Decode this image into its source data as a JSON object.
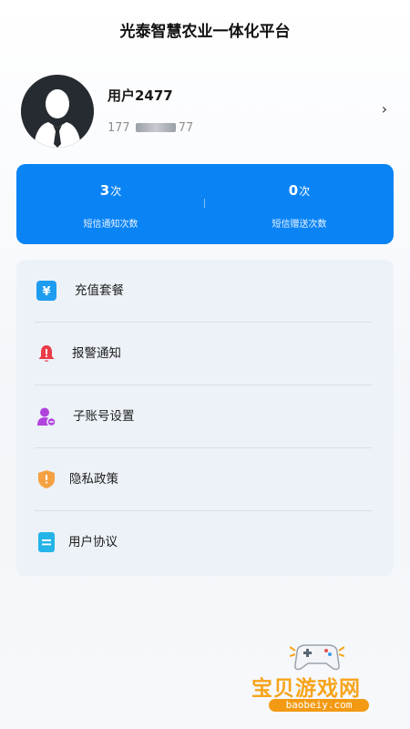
{
  "header": {
    "title": "光泰智慧农业一体化平台"
  },
  "profile": {
    "username": "用户2477",
    "phone_prefix": "177",
    "phone_suffix": "77",
    "avatar": "user-avatar-icon",
    "arrow": "›"
  },
  "stats": {
    "sms_notify": {
      "value": "3",
      "unit": "次",
      "label": "短信通知次数"
    },
    "sms_gift": {
      "value": "0",
      "unit": "次",
      "label": "短信赠送次数"
    }
  },
  "menu": {
    "items": [
      {
        "label": "充值套餐",
        "icon": "yuan-icon",
        "color": "#1e9cf0"
      },
      {
        "label": "报警通知",
        "icon": "alarm-bell-icon",
        "color": "#ea3b49"
      },
      {
        "label": "子账号设置",
        "icon": "sub-account-icon",
        "color": "#b043dc"
      },
      {
        "label": "隐私政策",
        "icon": "shield-icon",
        "color": "#f5a142"
      },
      {
        "label": "用户协议",
        "icon": "document-icon",
        "color": "#25b4e8"
      }
    ]
  },
  "watermark": {
    "title": "宝贝游戏网",
    "url": "baobeiy.com"
  },
  "colors": {
    "accent": "#0a84f5",
    "menu_bg": "#edf2f8"
  }
}
